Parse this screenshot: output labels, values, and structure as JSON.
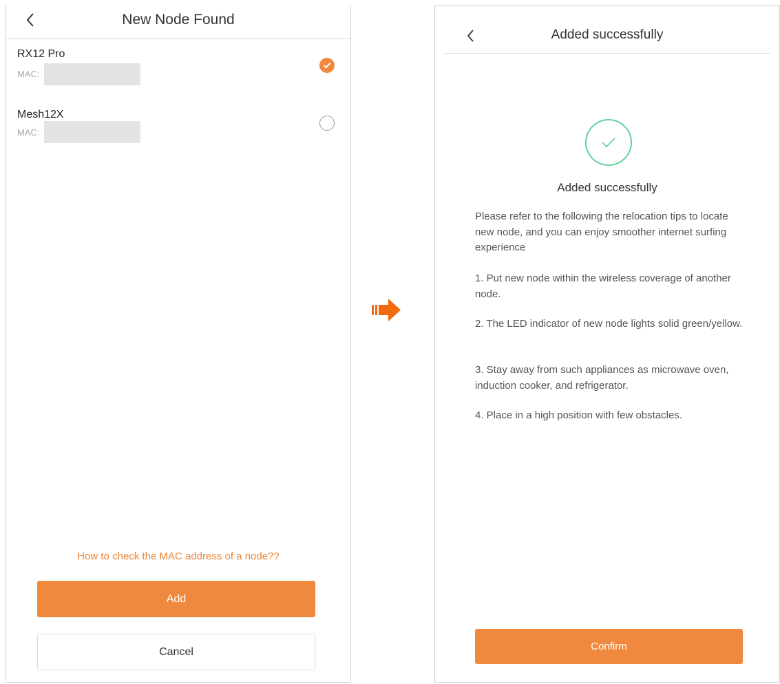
{
  "left_screen": {
    "title": "New Node Found",
    "nodes": [
      {
        "name": "RX12 Pro",
        "mac_label": "MAC:",
        "selected": true
      },
      {
        "name": "Mesh12X",
        "mac_label": "MAC:",
        "selected": false
      }
    ],
    "help_link": "How to check the MAC address of a node??",
    "add_label": "Add",
    "cancel_label": "Cancel"
  },
  "right_screen": {
    "title": "Added successfully",
    "success_heading": "Added successfully",
    "intro": "Please refer to the following the relocation tips to locate new node, and you can enjoy smoother internet surfing experience",
    "tips": [
      "1. Put new node within the wireless coverage of another node.",
      "2. The LED indicator of new node lights solid green/yellow.",
      "3. Stay away from such appliances as microwave oven, induction cooker, and refrigerator.",
      "4. Place in a high position with few obstacles."
    ],
    "confirm_label": "Confirm"
  },
  "colors": {
    "accent": "#f0883d",
    "success": "#63d19e",
    "arrow": "#f26a10"
  },
  "icons": [
    "back-arrow-icon",
    "checkmark-icon",
    "radio-unchecked-icon",
    "right-arrow-icon",
    "success-check-icon"
  ]
}
